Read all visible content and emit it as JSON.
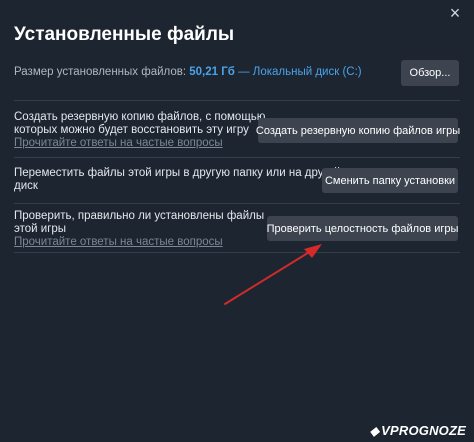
{
  "dialog": {
    "title": "Установленные файлы",
    "close_glyph": "×"
  },
  "size_info": {
    "label": "Размер установленных файлов:",
    "size_value": "50,21 Гб",
    "separator": "—",
    "disk": "Локальный диск (C:)",
    "browse_label": "Обзор..."
  },
  "backup": {
    "text_line1": "Создать резервную копию файлов, с помощью",
    "text_line2": "которых можно будет восстановить эту игру",
    "faq_link": "Прочитайте ответы на частые вопросы",
    "button_label": "Создать резервную копию файлов игры"
  },
  "move": {
    "text_line1": "Переместить файлы этой игры в другую папку или на другой",
    "text_line2": "диск",
    "button_label": "Сменить папку установки"
  },
  "verify": {
    "text_line1": "Проверить, правильно ли установлены файлы",
    "text_line2": "этой игры",
    "faq_link": "Прочитайте ответы на частые вопросы",
    "button_label": "Проверить целостность файлов игры"
  },
  "annotation": {
    "arrow_color": "#d42a2a",
    "arrow_icon": "red-arrow-icon"
  },
  "watermark": {
    "text": "VPROGNOZE",
    "icon": "shield-check-icon"
  },
  "colors": {
    "background": "#1d2530",
    "button": "#3d4450",
    "accent": "#4aa3ea"
  }
}
